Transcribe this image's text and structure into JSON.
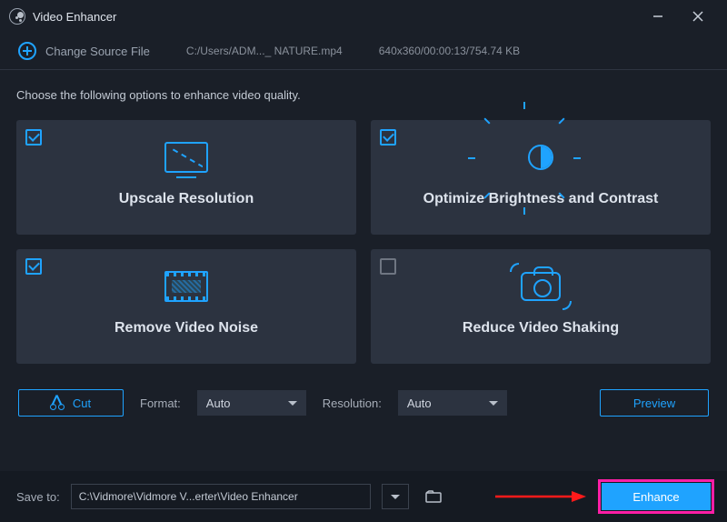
{
  "window": {
    "title": "Video Enhancer"
  },
  "source": {
    "change_label": "Change Source File",
    "path": "C:/Users/ADM..._ NATURE.mp4",
    "meta": "640x360/00:00:13/754.74 KB"
  },
  "instruction": "Choose the following options to enhance video quality.",
  "cards": {
    "upscale": {
      "label": "Upscale Resolution",
      "checked": true
    },
    "bright": {
      "label": "Optimize Brightness and Contrast",
      "checked": true
    },
    "denoise": {
      "label": "Remove Video Noise",
      "checked": true
    },
    "deshake": {
      "label": "Reduce Video Shaking",
      "checked": false
    }
  },
  "controls": {
    "cut": "Cut",
    "format_label": "Format:",
    "format_value": "Auto",
    "resolution_label": "Resolution:",
    "resolution_value": "Auto",
    "preview": "Preview"
  },
  "footer": {
    "save_label": "Save to:",
    "save_path": "C:\\Vidmore\\Vidmore V...erter\\Video Enhancer",
    "enhance": "Enhance"
  }
}
